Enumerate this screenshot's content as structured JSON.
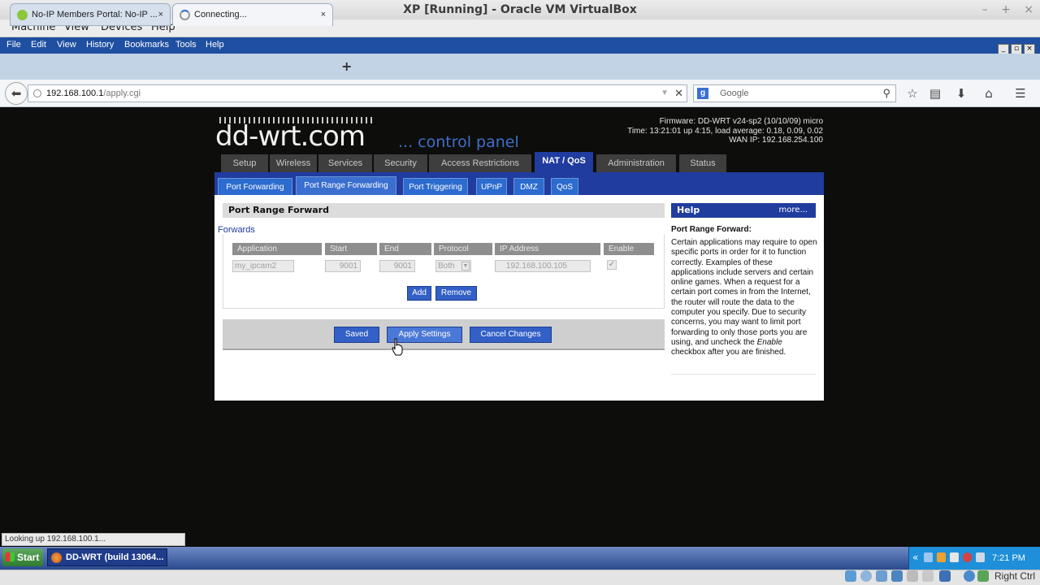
{
  "vbox": {
    "title": "XP [Running] - Oracle VM VirtualBox",
    "window_controls": [
      "–",
      "+",
      "×"
    ],
    "menu": [
      "Machine",
      "View",
      "Devices",
      "Help"
    ],
    "host_key": "Right Ctrl"
  },
  "firefox": {
    "menu": [
      "File",
      "Edit",
      "View",
      "History",
      "Bookmarks",
      "Tools",
      "Help"
    ],
    "window_controls": [
      "_",
      "▫",
      "×"
    ],
    "tabs": [
      {
        "label": "No-IP Members Portal: No-IP ...",
        "close": "×"
      },
      {
        "label": "Connecting...",
        "close": "×"
      }
    ],
    "new_tab": "+",
    "url_host": "192.168.100.1",
    "url_path": "/apply.cgi",
    "search_engine": "g",
    "search_placeholder": "Google",
    "status_text": "Looking up 192.168.100.1..."
  },
  "router": {
    "logo_main": "dd-wrt.com",
    "logo_sub": "... control panel",
    "info": [
      "Firmware: DD-WRT v24-sp2 (10/10/09) micro",
      "Time: 13:21:01 up 4:15, load average: 0.18, 0.09, 0.02",
      "WAN IP: 192.168.254.100"
    ],
    "main_tabs": [
      "Setup",
      "Wireless",
      "Services",
      "Security",
      "Access Restrictions",
      "NAT / QoS",
      "Administration",
      "Status"
    ],
    "sub_tabs": [
      "Port Forwarding",
      "Port Range Forwarding",
      "Port Triggering",
      "UPnP",
      "DMZ",
      "QoS"
    ],
    "section_title": "Port Range Forward",
    "forwards_label": "Forwards",
    "columns": [
      "Application",
      "Start",
      "End",
      "Protocol",
      "IP Address",
      "Enable"
    ],
    "row": {
      "application": "my_ipcam2",
      "start": "9001",
      "end": "9001",
      "protocol": "Both",
      "ip": "192.168.100.105",
      "enabled": "✓"
    },
    "add_btn": "Add",
    "remove_btn": "Remove",
    "saved_btn": "Saved",
    "apply_btn": "Apply Settings",
    "cancel_btn": "Cancel Changes",
    "help": {
      "head": "Help",
      "more": "more...",
      "title": "Port Range Forward:",
      "body_1": "Certain applications may require to open specific ports in order for it to function correctly. Examples of these applications include servers and certain online games. When a request for a certain port comes in from the Internet, the router will route the data to the computer you specify. Due to security concerns, you may want to limit port forwarding to only those ports you are using, and uncheck the ",
      "body_em": "Enable",
      "body_2": " checkbox after you are finished."
    }
  },
  "xp": {
    "start": "Start",
    "task_firefox": "DD-WRT (build 13064...",
    "tray_chevron": "«",
    "clock": "7:21 PM"
  },
  "colors": {
    "router_blue": "#1f3c9e",
    "button_blue": "#3360c6",
    "xp_taskbar": "#2a4b8f"
  }
}
